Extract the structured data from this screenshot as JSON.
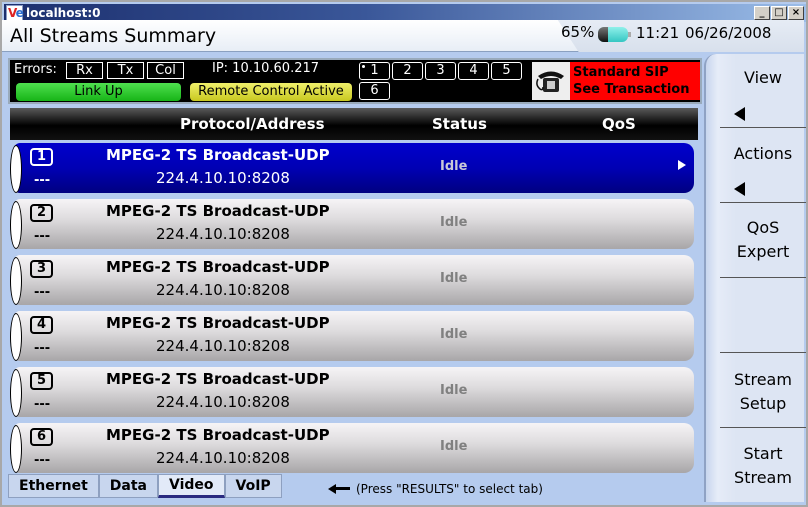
{
  "window": {
    "title": "localhost:0",
    "icon": "ve-app-icon",
    "controls": [
      "minimize",
      "maximize",
      "close"
    ]
  },
  "header": {
    "title": "All Streams Summary",
    "battery_percent": "65%",
    "battery_level": 0.65,
    "time": "11:21",
    "date": "06/26/2008"
  },
  "infobar": {
    "errors_label": "Errors:",
    "error_indicators": [
      "Rx",
      "Tx",
      "Col"
    ],
    "ip_label": "IP:  10.10.60.217",
    "link_status": "Link Up",
    "remote_status": "Remote Control Active",
    "stream_selectors": [
      "1",
      "2",
      "3",
      "4",
      "5",
      "6"
    ],
    "active_stream": "1",
    "sip_line1": "Standard SIP",
    "sip_line2": "See Transaction",
    "colors": {
      "link": "#22c422",
      "remote": "#dddd40",
      "sip": "#ff0000"
    }
  },
  "table": {
    "columns": [
      "Protocol/Address",
      "Status",
      "QoS"
    ],
    "rows": [
      {
        "num": "1",
        "dash": "---",
        "protocol": "MPEG-2 TS Broadcast-UDP",
        "address": "224.4.10.10:8208",
        "status": "Idle",
        "qos": "",
        "selected": true
      },
      {
        "num": "2",
        "dash": "---",
        "protocol": "MPEG-2 TS Broadcast-UDP",
        "address": "224.4.10.10:8208",
        "status": "Idle",
        "qos": "",
        "selected": false
      },
      {
        "num": "3",
        "dash": "---",
        "protocol": "MPEG-2 TS Broadcast-UDP",
        "address": "224.4.10.10:8208",
        "status": "Idle",
        "qos": "",
        "selected": false
      },
      {
        "num": "4",
        "dash": "---",
        "protocol": "MPEG-2 TS Broadcast-UDP",
        "address": "224.4.10.10:8208",
        "status": "Idle",
        "qos": "",
        "selected": false
      },
      {
        "num": "5",
        "dash": "---",
        "protocol": "MPEG-2 TS Broadcast-UDP",
        "address": "224.4.10.10:8208",
        "status": "Idle",
        "qos": "",
        "selected": false
      },
      {
        "num": "6",
        "dash": "---",
        "protocol": "MPEG-2 TS Broadcast-UDP",
        "address": "224.4.10.10:8208",
        "status": "Idle",
        "qos": "",
        "selected": false
      }
    ]
  },
  "tabs": [
    {
      "label": "Ethernet",
      "active": false
    },
    {
      "label": "Data",
      "active": false
    },
    {
      "label": "Video",
      "active": true
    },
    {
      "label": "VoIP",
      "active": false
    }
  ],
  "hint": "(Press \"RESULTS\" to select tab)",
  "sidebar": {
    "buttons": [
      {
        "label1": "View",
        "label2": "",
        "submenu": true
      },
      {
        "label1": "Actions",
        "label2": "",
        "submenu": true
      },
      {
        "label1": "QoS",
        "label2": "Expert",
        "submenu": false
      },
      {
        "label1": "",
        "label2": "",
        "submenu": false
      },
      {
        "label1": "Stream",
        "label2": "Setup",
        "submenu": false
      },
      {
        "label1": "Start",
        "label2": "Stream",
        "submenu": false
      }
    ]
  }
}
